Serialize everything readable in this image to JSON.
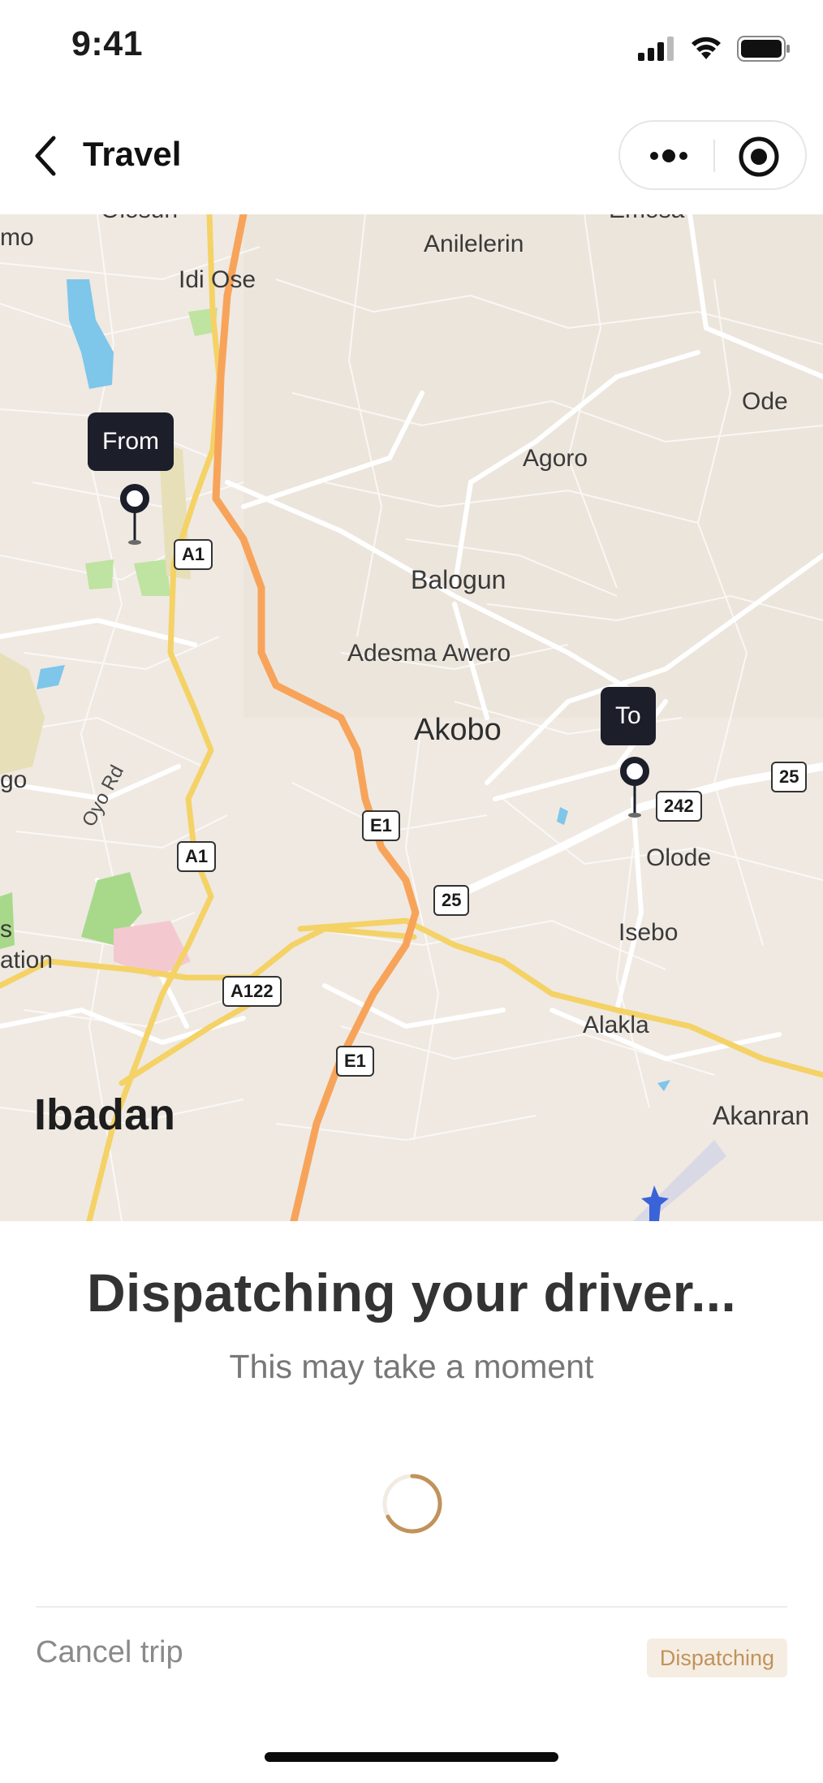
{
  "status_bar": {
    "time": "9:41"
  },
  "nav": {
    "title": "Travel"
  },
  "map": {
    "from_label": "From",
    "to_label": "To",
    "places": [
      "Olosun",
      "Emosa",
      "Anilelerin",
      "Idi Ose",
      "Ode",
      "Agoro",
      "Balogun",
      "Adesma Awero",
      "Akobo",
      "Olode",
      "Isebo",
      "Alakla",
      "Akanran",
      "Ibadan",
      "Oyo Rd",
      "mo",
      "go",
      "s",
      "ation"
    ],
    "road_shields": [
      "A1",
      "A1",
      "E1",
      "E1",
      "25",
      "25",
      "242",
      "A122"
    ]
  },
  "sheet": {
    "title": "Dispatching your driver...",
    "subtitle": "This may take a moment",
    "cancel_label": "Cancel trip",
    "status_badge": "Dispatching"
  },
  "colors": {
    "accent": "#c0935b",
    "badge_bg": "#f6ede2",
    "map_bg": "#efe9e2",
    "highway": "#f7a45a",
    "primary_road": "#f4d266",
    "pin": "#1c1f2a"
  }
}
